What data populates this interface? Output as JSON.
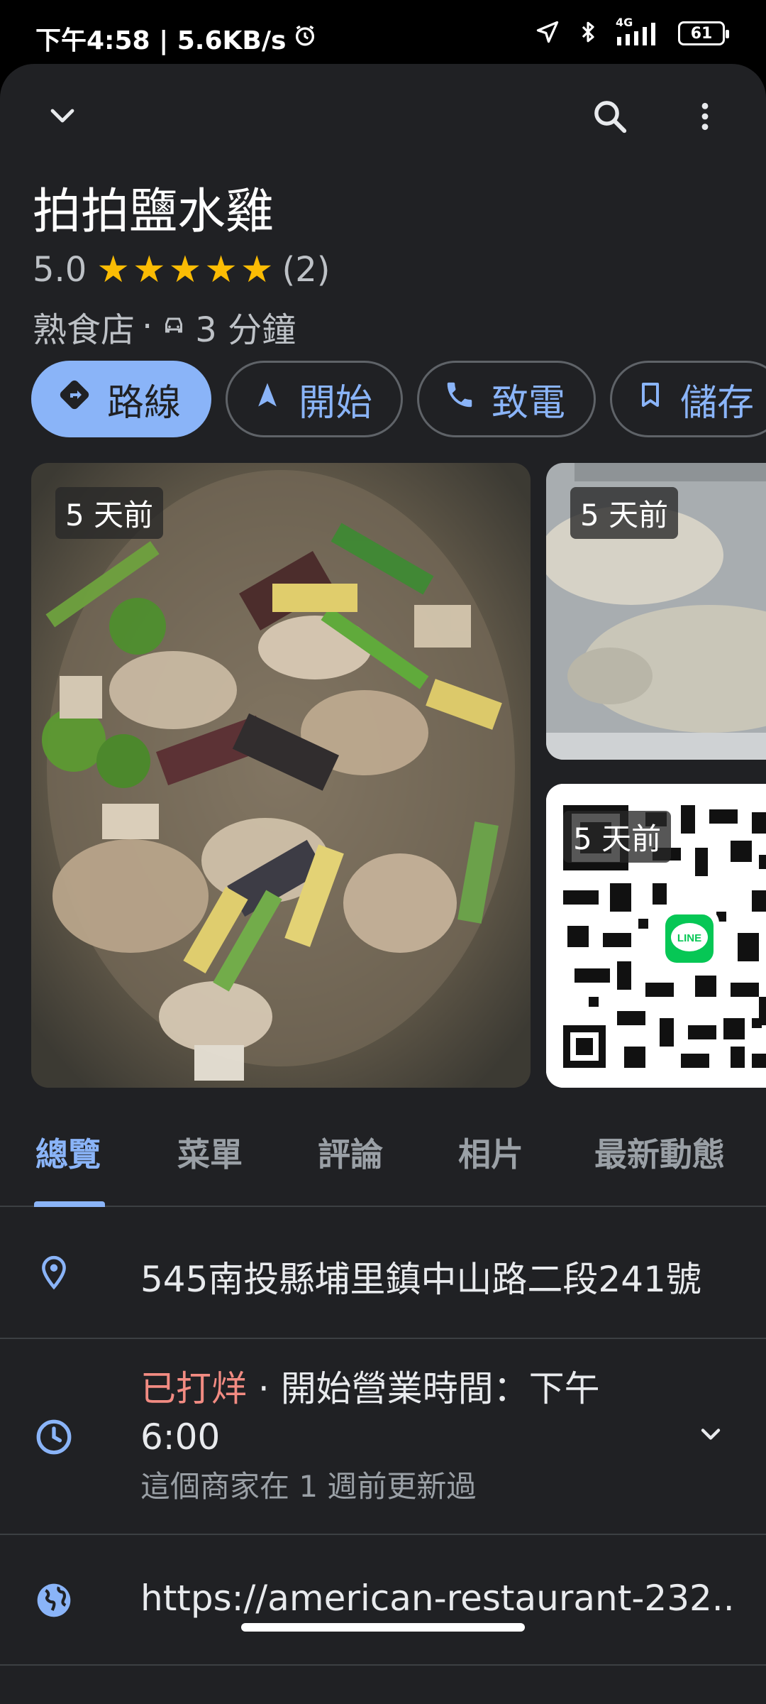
{
  "status": {
    "time_speed": "下午4:58 | 5.6KB/s",
    "network": "4G",
    "battery": "61"
  },
  "place": {
    "name": "拍拍鹽水雞",
    "rating": "5.0",
    "review_count": "(2)",
    "category": "熟食店",
    "separator": "·",
    "drive_time": "3 分鐘"
  },
  "actions": {
    "directions": "路線",
    "start": "開始",
    "call": "致電",
    "save": "儲存"
  },
  "photos": [
    {
      "badge": "5 天前"
    },
    {
      "badge": "5 天前"
    },
    {
      "badge": "5 天前",
      "logo_text": "LINE"
    }
  ],
  "tabs": [
    "總覽",
    "菜單",
    "評論",
    "相片",
    "最新動態"
  ],
  "info": {
    "address": "545南投縣埔里鎮中山路二段241號",
    "hours_status": "已打烊",
    "hours_sep": " · ",
    "hours_detail": "開始營業時間：下午 6:00",
    "hours_updated": "這個商家在 1 週前更新過",
    "website": "https://american-restaurant-232..."
  },
  "colors": {
    "accent": "#8ab4f8",
    "star": "#fbbc04",
    "closed": "#f28b82",
    "background": "#202124"
  }
}
